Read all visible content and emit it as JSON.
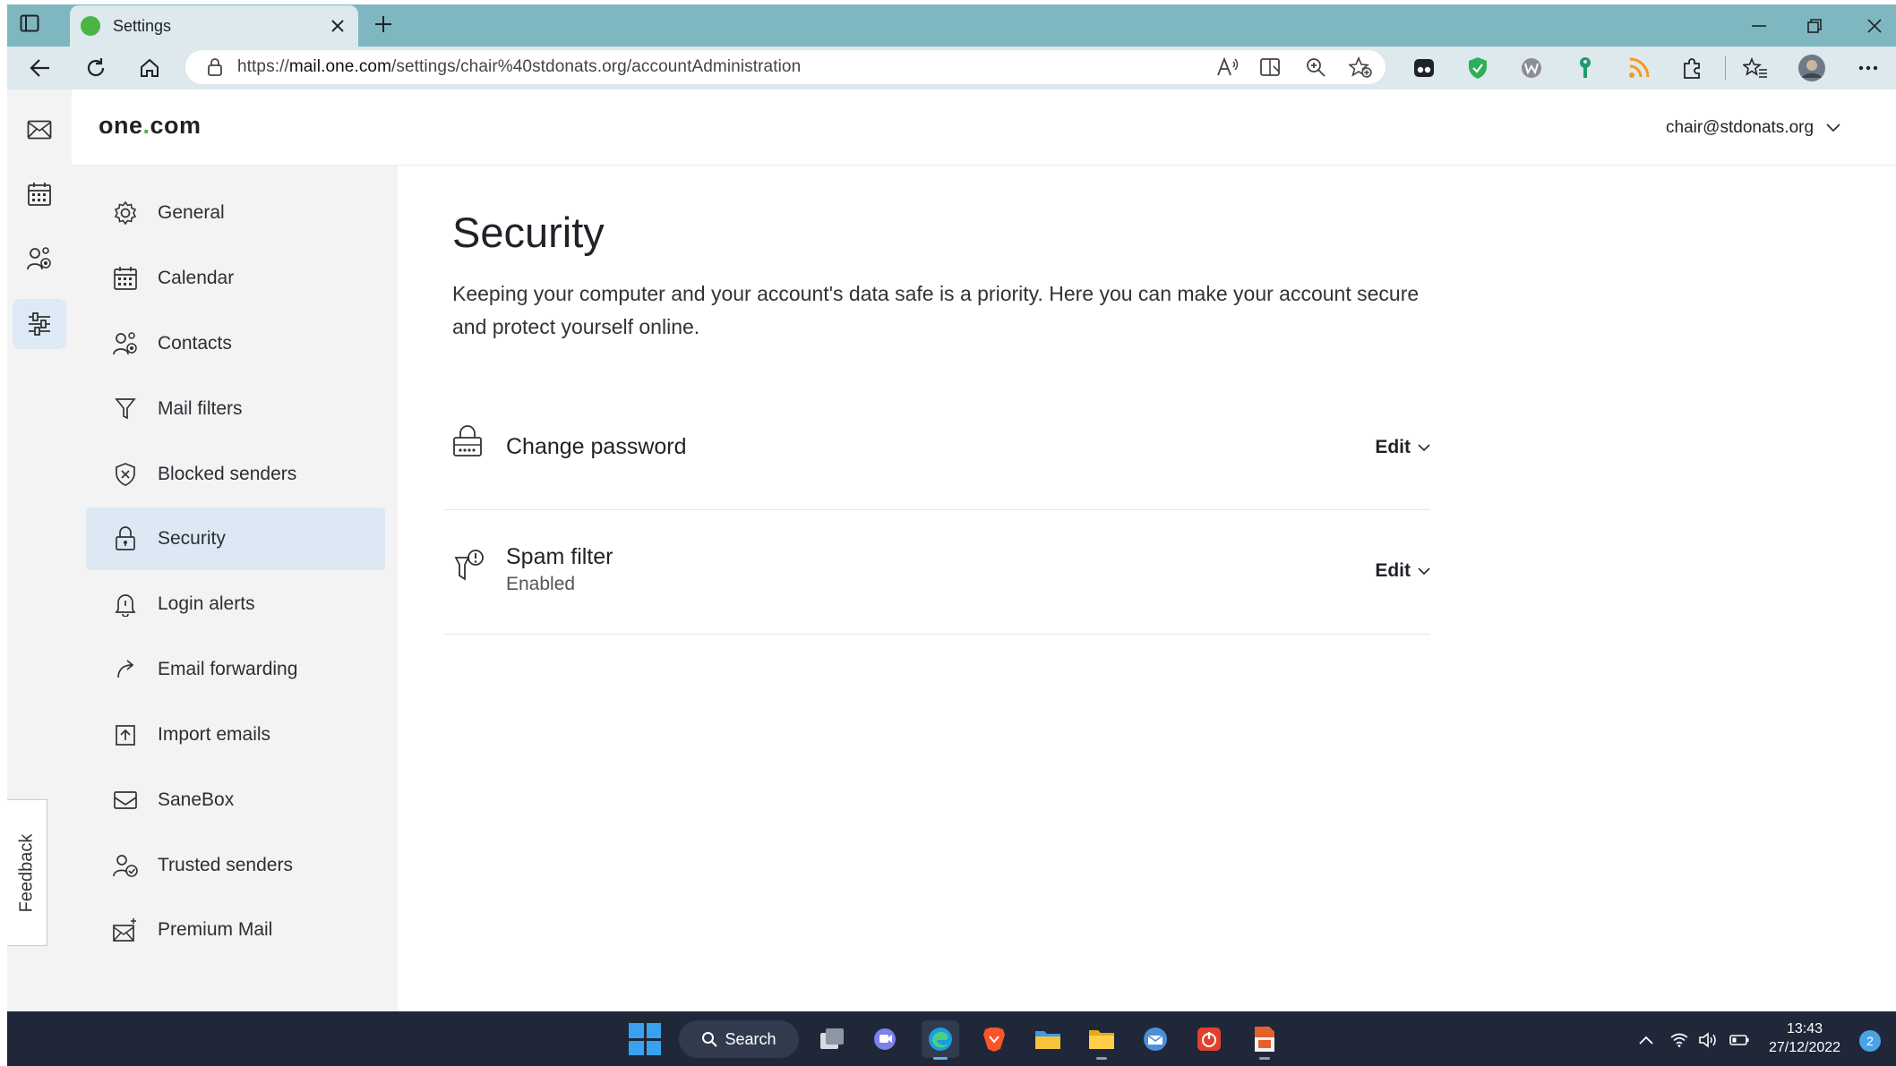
{
  "browser": {
    "tab_title": "Settings",
    "url_prefix": "https://",
    "url_host": "mail.one.com",
    "url_path": "/settings/chair%40stdonats.org/accountAdministration"
  },
  "app": {
    "logo_main": "one",
    "logo_dot": ".",
    "logo_suffix": "com",
    "account_email": "chair@stdonats.org",
    "feedback_label": "Feedback"
  },
  "settings_nav": {
    "items": [
      {
        "label": "General",
        "icon": "gear-icon"
      },
      {
        "label": "Calendar",
        "icon": "calendar-icon"
      },
      {
        "label": "Contacts",
        "icon": "contacts-icon"
      },
      {
        "label": "Mail filters",
        "icon": "filter-icon"
      },
      {
        "label": "Blocked senders",
        "icon": "shield-x-icon"
      },
      {
        "label": "Security",
        "icon": "lock-icon",
        "active": true
      },
      {
        "label": "Login alerts",
        "icon": "bell-icon"
      },
      {
        "label": "Email forwarding",
        "icon": "forward-arrow-icon"
      },
      {
        "label": "Import emails",
        "icon": "import-icon"
      },
      {
        "label": "SaneBox",
        "icon": "inbox-icon"
      },
      {
        "label": "Trusted senders",
        "icon": "trusted-user-icon"
      },
      {
        "label": "Premium Mail",
        "icon": "sparkle-mail-icon"
      }
    ]
  },
  "main": {
    "title": "Security",
    "description": "Keeping your computer and your account's data safe is a priority. Here you can make your account secure and protect yourself online.",
    "rows": [
      {
        "title": "Change password",
        "subtitle": "",
        "action": "Edit",
        "icon": "password-lock-icon"
      },
      {
        "title": "Spam filter",
        "subtitle": "Enabled",
        "action": "Edit",
        "icon": "spam-filter-icon"
      }
    ]
  },
  "taskbar": {
    "search_label": "Search",
    "time": "13:43",
    "date": "27/12/2022",
    "notification_count": "2"
  },
  "colors": {
    "accent_green": "#3cb649",
    "active_nav_bg": "#dce9f5",
    "browser_chrome": "#7fb7c0",
    "taskbar_bg": "#1f2738"
  }
}
